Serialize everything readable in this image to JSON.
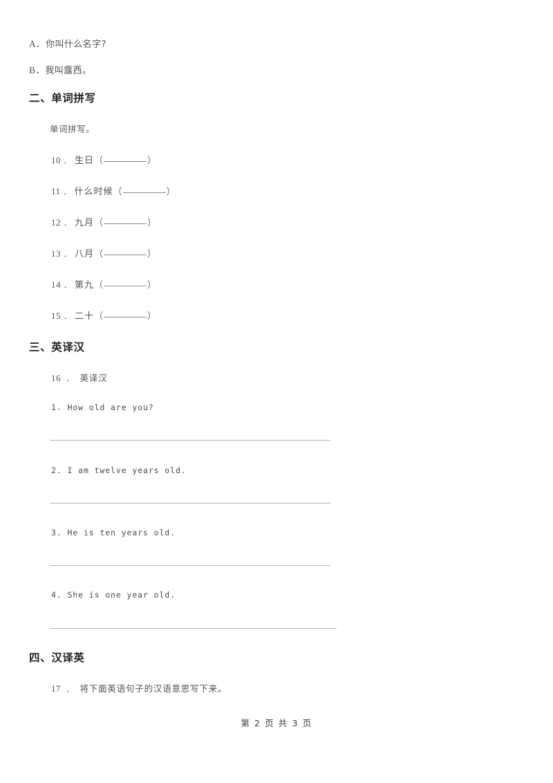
{
  "document": {
    "page_label": "第 2 页 共 3 页",
    "page_number": "2",
    "total_pages": "3"
  },
  "carryover_options": [
    {
      "label": "A．",
      "text": "你叫什么名字?"
    },
    {
      "label": "B．",
      "text": "我叫露西。"
    }
  ],
  "sections": [
    {
      "heading": "二、单词拼写",
      "instruction": "单词拼写。",
      "items": [
        {
          "num": "10",
          "dot": "．",
          "word": "生日",
          "open": "（",
          "close": "）",
          "gap": "  "
        },
        {
          "num": "11",
          "dot": "．",
          "word": "什么时候",
          "open": "（",
          "close": "）",
          "gap": ""
        },
        {
          "num": "12",
          "dot": "．",
          "word": "九月",
          "open": "（",
          "close": "）",
          "gap": "  "
        },
        {
          "num": "13",
          "dot": "．",
          "word": "八月",
          "open": "（",
          "close": "）",
          "gap": "  "
        },
        {
          "num": "14",
          "dot": "．",
          "word": "第九",
          "open": "（",
          "close": "）",
          "gap": "  "
        },
        {
          "num": "15",
          "dot": "．",
          "word": "二十",
          "open": "（",
          "close": "）",
          "gap": "  "
        }
      ]
    },
    {
      "heading": "三、英译汉",
      "question": {
        "num": "16",
        "dot": "．",
        "text": "英译汉"
      },
      "sentences": [
        {
          "text": "1. How old are you?"
        },
        {
          "text": "2. I am twelve years old."
        },
        {
          "text": "3. He is ten years old."
        },
        {
          "text": "4. She is one year old."
        }
      ]
    },
    {
      "heading": "四、汉译英",
      "question": {
        "num": "17",
        "dot": "．",
        "text": "将下面英语句子的汉语意思写下来。"
      }
    }
  ]
}
